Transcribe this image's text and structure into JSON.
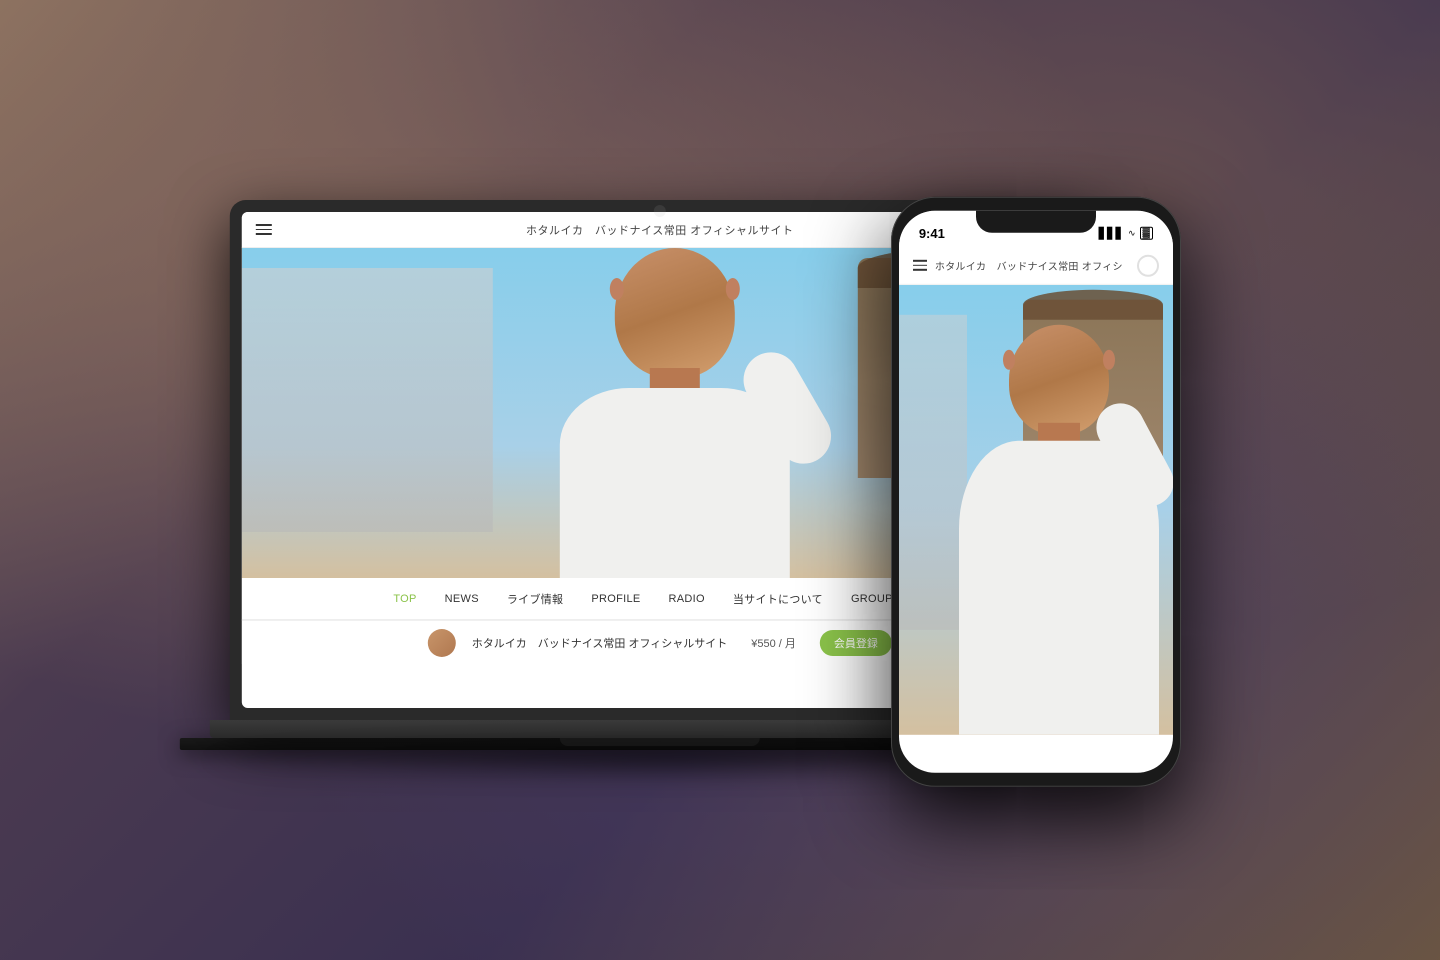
{
  "background": {
    "color": "#5a4a5a"
  },
  "laptop": {
    "site": {
      "header": {
        "title": "ホタルイカ　バッドナイス常田 オフィシャルサイト",
        "menu_icon": "hamburger"
      },
      "nav": {
        "items": [
          {
            "label": "TOP",
            "active": true
          },
          {
            "label": "NEWS",
            "active": false
          },
          {
            "label": "ライブ情報",
            "active": false
          },
          {
            "label": "PROFILE",
            "active": false
          },
          {
            "label": "RADIO",
            "active": false
          },
          {
            "label": "当サイトについて",
            "active": false
          },
          {
            "label": "GROUP CHAT",
            "active": false
          }
        ]
      },
      "footer_bar": {
        "site_name": "ホタルイカ　バッドナイス常田 オフィシャルサイト",
        "price": "¥550 / 月",
        "cta_label": "会員登録"
      }
    }
  },
  "phone": {
    "status_bar": {
      "time": "9:41",
      "signal": "▋▋▋",
      "wifi": "WiFi",
      "battery": "🔋"
    },
    "header": {
      "title": "ホタルイカ　バッドナイス常田 オフィシ",
      "menu_icon": "hamburger"
    }
  }
}
